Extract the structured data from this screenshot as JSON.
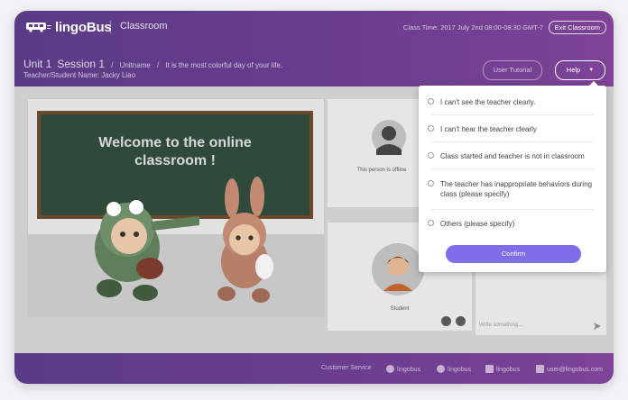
{
  "header": {
    "logo_text": "lingoBus",
    "section": "Classroom",
    "class_time": "Class Time: 2017 July 2nd  08:00-08:30  GMT-7",
    "exit_label": "Exit Classroom"
  },
  "lesson": {
    "unit": "Unit 1",
    "session": "Session 1",
    "unitname": "Unitname",
    "subtitle": "It is the most colorful day of your life.",
    "teacher_student": "Teacher/Student Name: Jacky Liao"
  },
  "toolbar": {
    "tutorial_label": "User Tutorial",
    "help_label": "Help"
  },
  "board": {
    "welcome_line1": "Welcome to the online",
    "welcome_line2": "classroom !"
  },
  "videos": {
    "teacher_status": "This person is offline",
    "student_label": "Student"
  },
  "chat": {
    "placeholder": "Write something..."
  },
  "help_menu": {
    "options": [
      "I can't see the teacher clearly.",
      "I can't hear the teacher clearly",
      "Class started and teacher is not in classroom",
      "The teacher has inappropriate behaviors during class (please specify)",
      "Others (please specify)"
    ],
    "confirm_label": "Confirm"
  },
  "footer": {
    "customer_service": "Customer Service",
    "items": [
      "lingobus",
      "lingobus",
      "lingobus",
      "user@lingobus.com"
    ],
    "icons": [
      "phone-icon",
      "skype-icon",
      "facebook-icon",
      "mail-icon"
    ]
  },
  "colors": {
    "header_gradient_start": "#5a3b86",
    "header_gradient_end": "#7d4396",
    "confirm_button": "#7e6ee8"
  }
}
